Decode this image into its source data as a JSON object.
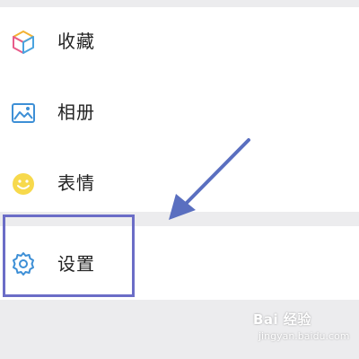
{
  "menu": {
    "items": [
      {
        "label": "收藏",
        "icon": "cube-icon"
      },
      {
        "label": "相册",
        "icon": "image-icon"
      },
      {
        "label": "表情",
        "icon": "smiley-icon"
      }
    ],
    "settings": {
      "label": "设置",
      "icon": "gear-icon"
    }
  },
  "annotation": {
    "arrow_color": "#5a6fc0",
    "highlight_color": "#6b6dc7"
  },
  "watermark": {
    "brand": "Bai 经验",
    "sub": "jingyan.baidu.com"
  }
}
